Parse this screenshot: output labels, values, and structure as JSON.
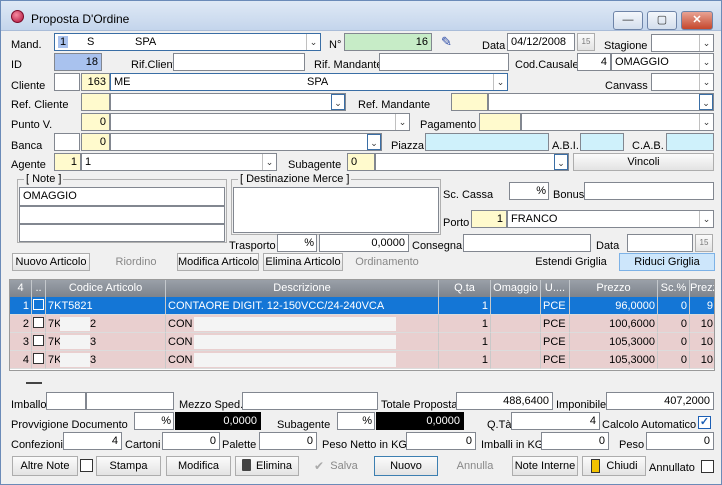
{
  "window": {
    "title": "Proposta D'Ordine",
    "min": "—",
    "max": "▢",
    "close": "✕"
  },
  "header": {
    "mand_label": "Mand.",
    "mand_code": "1",
    "mand_type": "S",
    "mand_name": "SPA",
    "n_label": "N°",
    "n_value": "16",
    "data_label": "Data",
    "data_value": "04/12/2008",
    "data_btn": "15",
    "stagione_label": "Stagione",
    "id_label": "ID",
    "id_value": "18",
    "rif_cliente_label": "Rif.Cliente",
    "rif_mandante_label": "Rif. Mandante",
    "cod_causale_label": "Cod.Causale",
    "cod_causale_code": "4",
    "cod_causale_value": "OMAGGIO",
    "cliente_label": "Cliente",
    "cliente_code": "163",
    "cliente_prefix": "ME",
    "cliente_name": "SPA",
    "canvass_label": "Canvass",
    "ref_cliente_label": "Ref. Cliente",
    "ref_mandante_label": "Ref. Mandante",
    "punto_label": "Punto V.",
    "punto_code": "0",
    "pagamento_label": "Pagamento",
    "banca_label": "Banca",
    "banca_code": "0",
    "piazza_label": "Piazza",
    "abi_label": "A.B.I.",
    "cab_label": "C.A.B.",
    "agente_label": "Agente",
    "agente_code": "1",
    "agente_value": "1",
    "subagente_label": "Subagente",
    "subagente_code": "0",
    "vincoli_label": "Vincoli"
  },
  "note": {
    "title": "[ Note ]",
    "line1": "OMAGGIO"
  },
  "destinazione": {
    "title": "[ Destinazione Merce ]"
  },
  "sc_cassa_label": "Sc. Cassa",
  "sc_cassa_unit": "%",
  "bonus_label": "Bonus",
  "porto_label": "Porto",
  "porto_code": "1",
  "porto_value": "FRANCO",
  "trasporto_label": "Trasporto",
  "trasporto_unit": "%",
  "trasporto_value": "0,0000",
  "consegna_label": "Consegna",
  "data2_label": "Data",
  "data2_btn": "15",
  "toolbar": {
    "nuovo_articolo": "Nuovo Articolo",
    "riordino": "Riordino",
    "modifica_articolo": "Modifica Articolo",
    "elimina_articolo": "Elimina Articolo",
    "ordinamento": "Ordinamento",
    "estendi": "Estendi Griglia",
    "riduci": "Riduci Griglia"
  },
  "grid": {
    "count": "4",
    "headers": [
      "4",
      "..",
      "Codice Articolo",
      "Descrizione",
      "Q.ta",
      "Omaggio",
      "U....",
      "Prezzo",
      "Sc.%",
      "Prezz"
    ],
    "rows": [
      {
        "n": "1",
        "code": "7KT5821",
        "desc": "CONTAORE DIGIT. 12-150VCC/24-240VCA",
        "qta": "1",
        "um": "PCE",
        "prezzo": "96,0000",
        "sc": "0",
        "last": "9"
      },
      {
        "n": "2",
        "code": "7K",
        "code2": "2",
        "desc": "CON",
        "qta": "1",
        "um": "PCE",
        "prezzo": "100,6000",
        "sc": "0",
        "last": "10"
      },
      {
        "n": "3",
        "code": "7K",
        "code2": "3",
        "desc": "CON",
        "qta": "1",
        "um": "PCE",
        "prezzo": "105,3000",
        "sc": "0",
        "last": "10"
      },
      {
        "n": "4",
        "code": "7K",
        "code2": "3",
        "desc": "CON",
        "qta": "1",
        "um": "PCE",
        "prezzo": "105,3000",
        "sc": "0",
        "last": "10"
      }
    ]
  },
  "totals": {
    "imballo_label": "Imballo",
    "mezzo_label": "Mezzo Sped.",
    "totale_label": "Totale Proposta",
    "totale_value": "488,6400",
    "imponibile_label": "Imponibile",
    "imponibile_value": "407,2000",
    "provv_label": "Provvigione Documento",
    "provv_unit": "%",
    "provv_value": "0,0000",
    "subagente_label": "Subagente",
    "sub_unit": "%",
    "sub_value": "0,0000",
    "qta_label": "Q.Tà",
    "qta_value": "4",
    "calcolo_label": "Calcolo Automatico",
    "confezioni_label": "Confezioni",
    "confezioni_value": "4",
    "cartoni_label": "Cartoni",
    "cartoni_value": "0",
    "palette_label": "Palette",
    "palette_value": "0",
    "peso_netto_label": "Peso Netto in KG",
    "peso_netto_value": "0",
    "imballi_label": "Imballi in KG",
    "imballi_value": "0",
    "peso_label": "Peso",
    "peso_value": "0"
  },
  "bottom": {
    "altre_note": "Altre Note",
    "stampa": "Stampa",
    "modifica": "Modifica",
    "elimina": "Elimina",
    "salva": "Salva",
    "nuovo": "Nuovo",
    "annulla": "Annulla",
    "note_interne": "Note Interne",
    "chiudi": "Chiudi",
    "annullato": "Annullato"
  }
}
